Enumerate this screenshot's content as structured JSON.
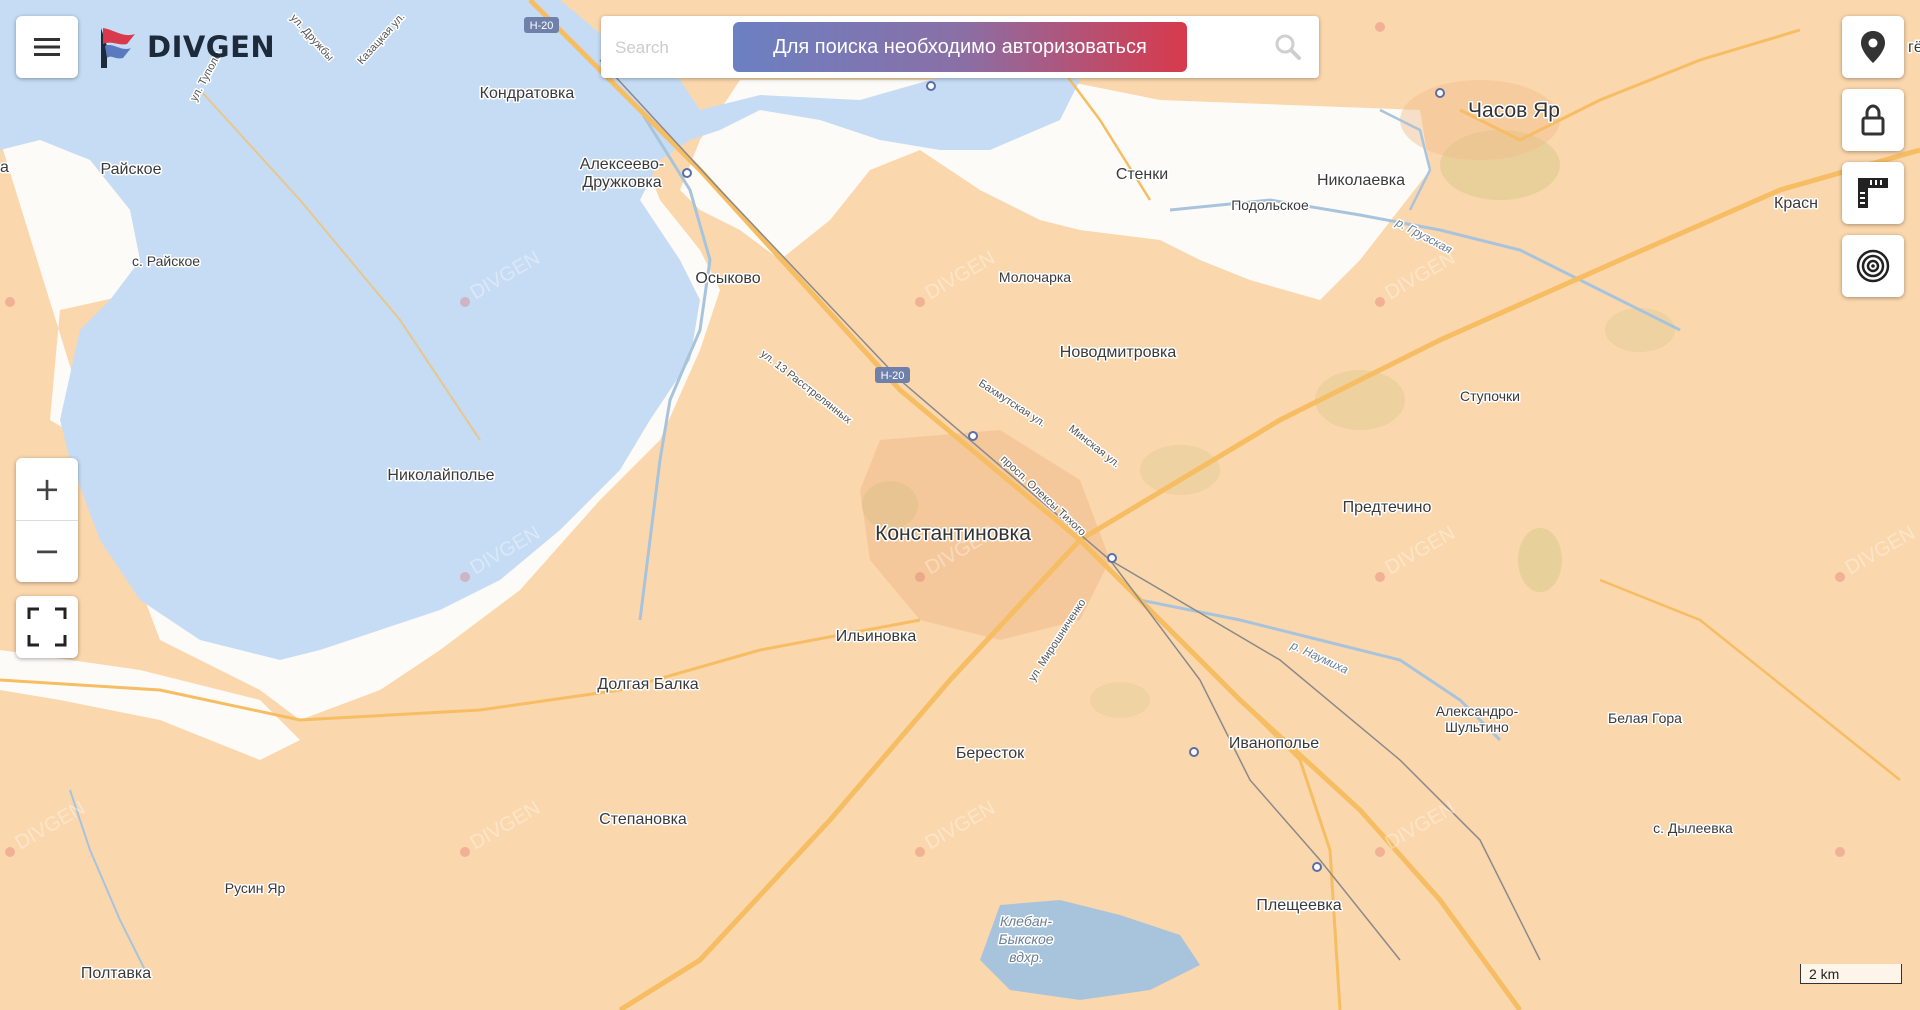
{
  "app": {
    "logo_text": "DIVGEN"
  },
  "search": {
    "placeholder": "Search",
    "auth_message": "Для поиска необходимо авторизоваться"
  },
  "watermark": "DIVGEN",
  "colors": {
    "occupied": "#fbd7ad",
    "contested_white": "#fdfbf7",
    "ukraine_control": "#c6dcf4",
    "water": "#a8c4dc",
    "road": "#f6bd63",
    "settlement": "#f0bc8c",
    "brand_red": "#d8394b"
  },
  "places": {
    "chasov_yar": "Часов Яр",
    "krasn": "Красн",
    "gyo": "гё",
    "kondratovka": "Кондратовка",
    "alekseevo_1": "Алексеево-",
    "alekseevo_2": "Дружковка",
    "raiskoe": "Райское",
    "s_raiskoe": "с. Райское",
    "stenki": "Стенки",
    "nikolaevka": "Николаевка",
    "podolskoe": "Подольское",
    "osykovo": "Осыково",
    "molocharka": "Молочарка",
    "novodmitrovka": "Новодмитровка",
    "stupochki": "Ступочки",
    "nikolaypolye": "Николайполье",
    "konstantinovka": "Константиновка",
    "predtechino": "Предтечино",
    "ilinovka": "Ильиновка",
    "dolgaya_balka": "Долгая Балка",
    "alexandro_1": "Александро-",
    "alexandro_2": "Шультино",
    "belaya_gora": "Белая Гора",
    "berestok": "Бересток",
    "ivanopolye": "Иванополье",
    "stepanovka": "Степановка",
    "s_dyleevka": "с. Дылеевка",
    "rusin_yar": "Русин Яр",
    "pleshcheevka": "Плещеевка",
    "poltavka": "Полтавка",
    "a_edge": "а"
  },
  "streets": {
    "druzhby": "ул. Дружбы",
    "kazatskaya": "Казацкая ул.",
    "tupolev": "ул. Туполе",
    "trinadtsat": "ул. 13 Расстрелянных",
    "bakhmutskaya": "Бахмутская ул.",
    "minskaya": "Минская ул.",
    "oleksy_tykhogo": "просп. Олексы Тихого",
    "miroshnichenko": "ул. Мирошниченко"
  },
  "water_labels": {
    "r_gruzskaya": "р. Грузская",
    "r_naumikha": "р. Наумиха",
    "reservoir_1": "Клебан-",
    "reservoir_2": "Быкское",
    "reservoir_3": "вдхр."
  },
  "road_shields": {
    "h20": "H-20"
  },
  "scale": {
    "label": "2 km"
  },
  "icons": {
    "menu": "hamburger-icon",
    "search": "magnifier-icon",
    "location": "map-pin-icon",
    "lock": "lock-icon",
    "ruler": "ruler-icon",
    "target": "target-icon",
    "zoom_in": "plus-icon",
    "zoom_out": "minus-icon",
    "fullscreen": "fullscreen-icon"
  },
  "zoom": {
    "in_symbol": "+",
    "out_symbol": "−"
  }
}
